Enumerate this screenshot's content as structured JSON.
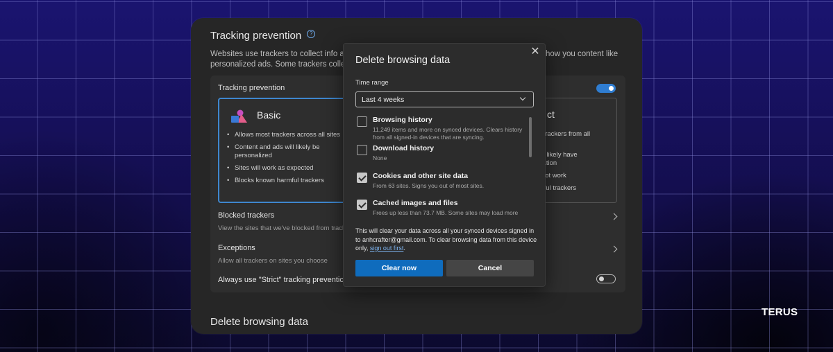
{
  "brand": "TERUS",
  "settings": {
    "title": "Tracking prevention",
    "description_left": "Websites use trackers to collect info about",
    "description_left_line2": "personalized ads. Some trackers collect and",
    "description_right": "how you content like",
    "card_label": "Tracking prevention",
    "basic": {
      "title": "Basic",
      "bullets": [
        "Allows most trackers across all sites",
        "Content and ads will likely be personalized",
        "Sites will work as expected",
        "Blocks known harmful trackers"
      ]
    },
    "strict": {
      "title_fragment": "ct",
      "fragments": [
        "ty of trackers from all",
        "s",
        "ls will likely have",
        "nalization",
        "ight not work",
        "harmful trackers"
      ]
    },
    "blocked": {
      "title": "Blocked trackers",
      "subtitle": "View the sites that we've blocked from tracking"
    },
    "exceptions": {
      "title": "Exceptions",
      "subtitle": "Allow all trackers on sites you choose"
    },
    "always_strict": {
      "title": "Always use \"Strict\" tracking prevention"
    },
    "section2_title": "Delete browsing data"
  },
  "dialog": {
    "title": "Delete browsing data",
    "close_glyph": "✕",
    "time_range_label": "Time range",
    "time_range_value": "Last 4 weeks",
    "items": [
      {
        "title": "Browsing history",
        "subtitle": "11,249 items and more on synced devices. Clears history from all signed-in devices that are syncing.",
        "checked": false
      },
      {
        "title": "Download history",
        "subtitle": "None",
        "checked": false
      },
      {
        "title": "Cookies and other site data",
        "subtitle": "From 63 sites. Signs you out of most sites.",
        "checked": true
      },
      {
        "title": "Cached images and files",
        "subtitle": "Frees up less than 73.7 MB. Some sites may load more",
        "checked": true
      }
    ],
    "notice": "This will clear your data across all your synced devices signed in to anhcrafter@gmail.com. To clear browsing data from this device only,",
    "notice_link": "sign out first",
    "notice_end": ".",
    "clear_label": "Clear now",
    "cancel_label": "Cancel"
  },
  "toggles": {
    "tracking_prevention": true,
    "always_strict": false
  },
  "colors": {
    "accent": "#0f6cbd",
    "selected_border": "#3e87cf",
    "link": "#7db4f0"
  }
}
